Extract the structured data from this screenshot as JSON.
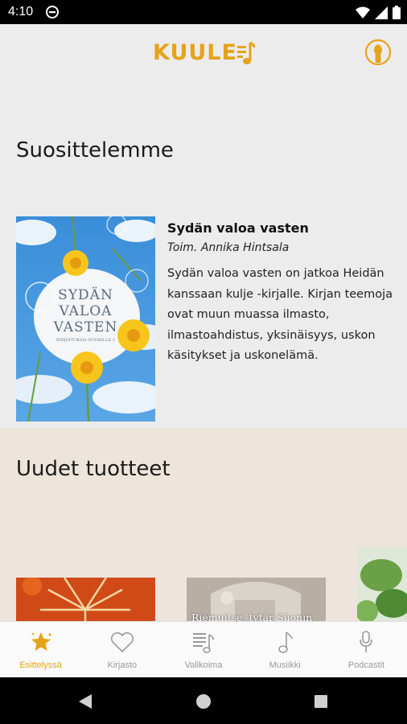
{
  "status_bar": {
    "time": "4:10"
  },
  "app": {
    "logo_text": "KUULE",
    "colors": {
      "accent": "#e5a31a",
      "featured_bg": "#ececec",
      "new_bg": "#ede5dc",
      "inactive": "#9a9a9a"
    }
  },
  "featured": {
    "title": "Suosittelemme",
    "book": {
      "cover_title_line1": "SYDÄN",
      "cover_title_line2": "VALOA",
      "cover_title_line3": "VASTEN",
      "cover_subtitle": "KIRJOITUKSIA NUORILLE 2",
      "title": "Sydän valoa vasten",
      "author": "Toim. Annika Hintsala",
      "description": "Sydän valoa vasten on jatkoa Heidän kanssaan kulje -kirjalle. Kirjan teemoja ovat muun muassa ilmasto, ilmastoahdistus, yksinäisyys, uskon käsitykset ja uskonelämä.",
      "formats": [
        "headphones-icon",
        "book-open-icon"
      ]
    }
  },
  "new_products": {
    "title": "Uudet tuotteet",
    "items": [
      {
        "label": ""
      },
      {
        "label": "Riemuitse, tytär Siionin"
      },
      {
        "label": ""
      }
    ]
  },
  "bottom_nav": {
    "items": [
      {
        "label": "Esittelyssä",
        "icon": "star-icon",
        "active": true
      },
      {
        "label": "Kirjasto",
        "icon": "heart-icon",
        "active": false
      },
      {
        "label": "Valikoima",
        "icon": "catalog-icon",
        "active": false
      },
      {
        "label": "Musiikki",
        "icon": "music-note-icon",
        "active": false
      },
      {
        "label": "Podcastit",
        "icon": "microphone-icon",
        "active": false
      }
    ]
  }
}
